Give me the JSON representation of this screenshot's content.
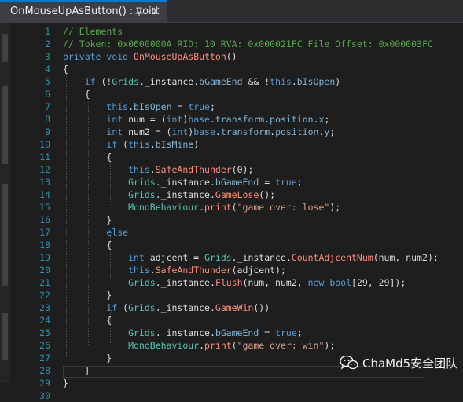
{
  "tab": {
    "title": "OnMouseUpAsButton() : void"
  },
  "watermark": {
    "text": "ChaMd5安全团队"
  },
  "line_numbers": [
    "1",
    "2",
    "3",
    "4",
    "5",
    "6",
    "7",
    "8",
    "9",
    "10",
    "11",
    "12",
    "13",
    "14",
    "15",
    "16",
    "17",
    "18",
    "19",
    "20",
    "21",
    "22",
    "23",
    "24",
    "25",
    "26",
    "27",
    "28",
    "29",
    "30"
  ],
  "code_lines": [
    [
      [
        "// Elements",
        "c-cm"
      ]
    ],
    [
      [
        "// Token: 0x0600000A RID: 10 RVA: 0x000021FC File Offset: 0x000003FC",
        "c-cm"
      ]
    ],
    [
      [
        "private",
        "c-kw"
      ],
      [
        " ",
        "c-pl"
      ],
      [
        "void",
        "c-kw"
      ],
      [
        " ",
        "c-pl"
      ],
      [
        "OnMouseUpAsButton",
        "c-me"
      ],
      [
        "()",
        "c-pl"
      ]
    ],
    [
      [
        "{",
        "c-pl"
      ]
    ],
    [
      [
        "    ",
        "c-pl"
      ],
      [
        "if",
        "c-kw"
      ],
      [
        " (!",
        "c-pl"
      ],
      [
        "Grids",
        "c-ty"
      ],
      [
        "._instance.",
        "c-pl"
      ],
      [
        "bGameEnd",
        "c-pr"
      ],
      [
        " && !",
        "c-pl"
      ],
      [
        "this",
        "c-kw"
      ],
      [
        ".",
        "c-pl"
      ],
      [
        "bIsOpen",
        "c-pr"
      ],
      [
        ")",
        "c-pl"
      ]
    ],
    [
      [
        "    {",
        "c-pl"
      ]
    ],
    [
      [
        "        ",
        "c-pl"
      ],
      [
        "this",
        "c-kw"
      ],
      [
        ".",
        "c-pl"
      ],
      [
        "bIsOpen",
        "c-pr"
      ],
      [
        " = ",
        "c-pl"
      ],
      [
        "true",
        "c-kw"
      ],
      [
        ";",
        "c-pl"
      ]
    ],
    [
      [
        "        ",
        "c-pl"
      ],
      [
        "int",
        "c-kw"
      ],
      [
        " num = (",
        "c-pl"
      ],
      [
        "int",
        "c-kw"
      ],
      [
        ")",
        "c-pl"
      ],
      [
        "base",
        "c-kw"
      ],
      [
        ".",
        "c-pl"
      ],
      [
        "transform",
        "c-pr"
      ],
      [
        ".",
        "c-pl"
      ],
      [
        "position",
        "c-pr"
      ],
      [
        ".",
        "c-pl"
      ],
      [
        "x",
        "c-pr"
      ],
      [
        ";",
        "c-pl"
      ]
    ],
    [
      [
        "        ",
        "c-pl"
      ],
      [
        "int",
        "c-kw"
      ],
      [
        " num2 = (",
        "c-pl"
      ],
      [
        "int",
        "c-kw"
      ],
      [
        ")",
        "c-pl"
      ],
      [
        "base",
        "c-kw"
      ],
      [
        ".",
        "c-pl"
      ],
      [
        "transform",
        "c-pr"
      ],
      [
        ".",
        "c-pl"
      ],
      [
        "position",
        "c-pr"
      ],
      [
        ".",
        "c-pl"
      ],
      [
        "y",
        "c-pr"
      ],
      [
        ";",
        "c-pl"
      ]
    ],
    [
      [
        "        ",
        "c-pl"
      ],
      [
        "if",
        "c-kw"
      ],
      [
        " (",
        "c-pl"
      ],
      [
        "this",
        "c-kw"
      ],
      [
        ".",
        "c-pl"
      ],
      [
        "bIsMine",
        "c-pr"
      ],
      [
        ")",
        "c-pl"
      ]
    ],
    [
      [
        "        {",
        "c-pl"
      ]
    ],
    [
      [
        "            ",
        "c-pl"
      ],
      [
        "this",
        "c-kw"
      ],
      [
        ".",
        "c-pl"
      ],
      [
        "SafeAndThunder",
        "c-me"
      ],
      [
        "(0);",
        "c-pl"
      ]
    ],
    [
      [
        "            ",
        "c-pl"
      ],
      [
        "Grids",
        "c-ty"
      ],
      [
        "._instance.",
        "c-pl"
      ],
      [
        "bGameEnd",
        "c-pr"
      ],
      [
        " = ",
        "c-pl"
      ],
      [
        "true",
        "c-kw"
      ],
      [
        ";",
        "c-pl"
      ]
    ],
    [
      [
        "            ",
        "c-pl"
      ],
      [
        "Grids",
        "c-ty"
      ],
      [
        "._instance.",
        "c-pl"
      ],
      [
        "GameLose",
        "c-me"
      ],
      [
        "();",
        "c-pl"
      ]
    ],
    [
      [
        "            ",
        "c-pl"
      ],
      [
        "MonoBehaviour",
        "c-ty"
      ],
      [
        ".",
        "c-pl"
      ],
      [
        "print",
        "c-me"
      ],
      [
        "(",
        "c-pl"
      ],
      [
        "\"game over: lose\"",
        "c-st"
      ],
      [
        ");",
        "c-pl"
      ]
    ],
    [
      [
        "        }",
        "c-pl"
      ]
    ],
    [
      [
        "        ",
        "c-pl"
      ],
      [
        "else",
        "c-kw"
      ]
    ],
    [
      [
        "        {",
        "c-pl"
      ]
    ],
    [
      [
        "            ",
        "c-pl"
      ],
      [
        "int",
        "c-kw"
      ],
      [
        " adjcent = ",
        "c-pl"
      ],
      [
        "Grids",
        "c-ty"
      ],
      [
        "._instance.",
        "c-pl"
      ],
      [
        "CountAdjcentNum",
        "c-me"
      ],
      [
        "(num, num2);",
        "c-pl"
      ]
    ],
    [
      [
        "            ",
        "c-pl"
      ],
      [
        "this",
        "c-kw"
      ],
      [
        ".",
        "c-pl"
      ],
      [
        "SafeAndThunder",
        "c-me"
      ],
      [
        "(adjcent);",
        "c-pl"
      ]
    ],
    [
      [
        "            ",
        "c-pl"
      ],
      [
        "Grids",
        "c-ty"
      ],
      [
        "._instance.",
        "c-pl"
      ],
      [
        "Flush",
        "c-me"
      ],
      [
        "(num, num2, ",
        "c-pl"
      ],
      [
        "new",
        "c-kw"
      ],
      [
        " ",
        "c-pl"
      ],
      [
        "bool",
        "c-kw"
      ],
      [
        "[29, 29]);",
        "c-pl"
      ]
    ],
    [
      [
        "        }",
        "c-pl"
      ]
    ],
    [
      [
        "        ",
        "c-pl"
      ],
      [
        "if",
        "c-kw"
      ],
      [
        " (",
        "c-pl"
      ],
      [
        "Grids",
        "c-ty"
      ],
      [
        "._instance.",
        "c-pl"
      ],
      [
        "GameWin",
        "c-me"
      ],
      [
        "())",
        "c-pl"
      ]
    ],
    [
      [
        "        {",
        "c-pl"
      ]
    ],
    [
      [
        "            ",
        "c-pl"
      ],
      [
        "Grids",
        "c-ty"
      ],
      [
        "._instance.",
        "c-pl"
      ],
      [
        "bGameEnd",
        "c-pr"
      ],
      [
        " = ",
        "c-pl"
      ],
      [
        "true",
        "c-kw"
      ],
      [
        ";",
        "c-pl"
      ]
    ],
    [
      [
        "            ",
        "c-pl"
      ],
      [
        "MonoBehaviour",
        "c-ty"
      ],
      [
        ".",
        "c-pl"
      ],
      [
        "print",
        "c-me"
      ],
      [
        "(",
        "c-pl"
      ],
      [
        "\"game over: win\"",
        "c-st"
      ],
      [
        ");",
        "c-pl"
      ]
    ],
    [
      [
        "        }",
        "c-pl"
      ]
    ],
    [
      [
        "    }",
        "c-pl"
      ]
    ],
    [
      [
        "}",
        "c-pl"
      ]
    ],
    [
      [
        "",
        "c-pl"
      ]
    ]
  ]
}
